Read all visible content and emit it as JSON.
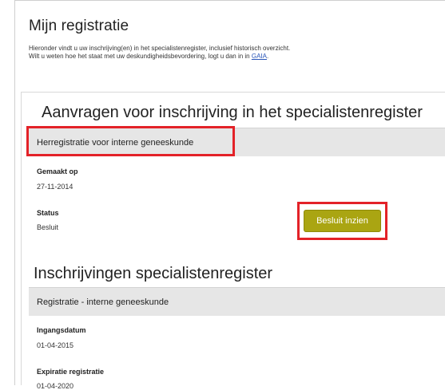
{
  "page": {
    "title": "Mijn registratie",
    "intro_line1": "Hieronder vindt u uw inschrijving(en) in het specialistenregister, inclusief historisch overzicht.",
    "intro_line2_prefix": "Wilt u weten hoe het staat met uw deskundigheidsbevordering, logt u dan in in ",
    "intro_link": "GAIA",
    "intro_line2_suffix": "."
  },
  "requests": {
    "heading": "Aanvragen voor inschrijving in het specialistenregister",
    "band_label": "Herregistratie voor interne geneeskunde",
    "created_label": "Gemaakt op",
    "created_value": "27-11-2014",
    "status_label": "Status",
    "status_value": "Besluit",
    "action_button": "Besluit inzien"
  },
  "registrations": {
    "heading": "Inschrijvingen specialistenregister",
    "band_label": "Registratie - interne geneeskunde",
    "start_label": "Ingangsdatum",
    "start_value": "01-04-2015",
    "expiry_label": "Expiratie registratie",
    "expiry_value": "01-04-2020"
  },
  "colors": {
    "highlight": "#e32228",
    "button": "#aaa512",
    "band": "#e6e6e6",
    "link": "#2a56b8"
  }
}
